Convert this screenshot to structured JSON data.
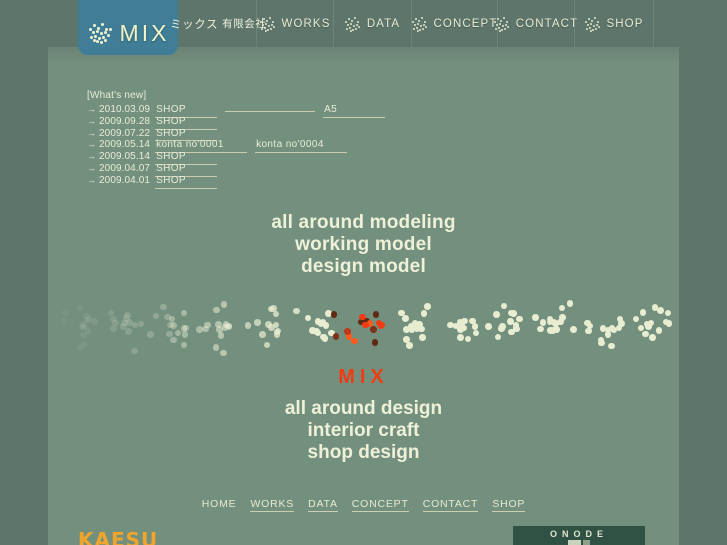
{
  "site": {
    "logo_text": "MIX",
    "brand_jp": "ミックス",
    "brand_jp_suffix": "有限会社"
  },
  "nav": {
    "items": [
      {
        "label": "WORKS",
        "icon": "dot-cluster-icon"
      },
      {
        "label": "DATA",
        "icon": "dot-cluster-icon"
      },
      {
        "label": "CONCEPT",
        "icon": "dot-cluster-icon"
      },
      {
        "label": "CONTACT",
        "icon": "dot-cluster-icon"
      },
      {
        "label": "SHOP",
        "icon": "dot-cluster-icon"
      }
    ]
  },
  "news": {
    "title": "[What's new]",
    "arrow": "→",
    "rows": [
      {
        "date": "2010.03.09",
        "links": [
          "SHOP",
          "",
          "A5"
        ]
      },
      {
        "date": "2009.09.28",
        "links": [
          "SHOP"
        ]
      },
      {
        "date": "2009.07.22",
        "links": [
          "SHOP"
        ]
      },
      {
        "date": "2009.05.14",
        "links": [
          "konta no'0001",
          "konta no'0004"
        ]
      },
      {
        "date": "2009.05.14",
        "links": [
          "SHOP"
        ]
      },
      {
        "date": "2009.04.07",
        "links": [
          "SHOP"
        ]
      },
      {
        "date": "2009.04.01",
        "links": [
          "SHOP"
        ]
      }
    ]
  },
  "hero": {
    "top_lines": [
      "all around modeling",
      "working model",
      "design model"
    ],
    "center_word": "MIX",
    "bottom_lines": [
      "all around design",
      "interior craft",
      "shop design"
    ]
  },
  "footer_nav": {
    "items": [
      {
        "label": "HOME",
        "underlined": false
      },
      {
        "label": "WORKS",
        "underlined": true
      },
      {
        "label": "DATA",
        "underlined": true
      },
      {
        "label": "CONCEPT",
        "underlined": true
      },
      {
        "label": "CONTACT",
        "underlined": true
      },
      {
        "label": "SHOP",
        "underlined": true
      }
    ]
  },
  "partners": {
    "kaesu": "KAESU",
    "onode": "ONODE"
  },
  "colors": {
    "page_background": "#5d756b",
    "content_background": "#73907f",
    "logo_tile": "#3f7e96",
    "accent_red": "#f23a13",
    "cream": "#eef1d7",
    "kaesu_orange": "#f0a52a",
    "onode_dark": "#2f5245"
  }
}
